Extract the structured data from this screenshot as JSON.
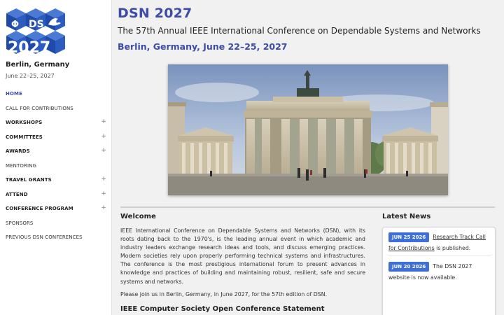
{
  "sidebar": {
    "logo": {
      "letters_top": "DS",
      "year": "2027"
    },
    "city": "Berlin, Germany",
    "dates": "June 22–25, 2027",
    "nav": [
      {
        "label": "HOME",
        "expandable": false
      },
      {
        "label": "CALL FOR CONTRIBUTIONS",
        "expandable": false
      },
      {
        "label": "WORKSHOPS",
        "expandable": true
      },
      {
        "label": "COMMITTEES",
        "expandable": true
      },
      {
        "label": "AWARDS",
        "expandable": true
      },
      {
        "label": "MENTORING",
        "expandable": false
      },
      {
        "label": "TRAVEL GRANTS",
        "expandable": true
      },
      {
        "label": "ATTEND",
        "expandable": true
      },
      {
        "label": "CONFERENCE PROGRAM",
        "expandable": true
      },
      {
        "label": "SPONSORS",
        "expandable": false
      },
      {
        "label": "PREVIOUS DSN CONFERENCES",
        "expandable": false
      }
    ],
    "expand_symbol": "+"
  },
  "main": {
    "title": "DSN 2027",
    "subtitle": "The 57th Annual IEEE International Conference on Dependable Systems and Networks",
    "location": "Berlin, Germany, June 22–25, 2027",
    "welcome": {
      "title": "Welcome",
      "body": "IEEE International Conference on Dependable Systems and Networks (DSN), with its roots dating back to the 1970's, is the leading annual event in which academic and industry leaders exchange research ideas and tools, and discuss emerging practices. Modern societies rely upon properly performing technical systems and infrastructures. The conference is the most prestigious international forum to present advances in knowledge and practices of building and maintaining robust, resilient, safe and secure systems and networks.",
      "join": "Please join us in Berlin, Germany, in June 2027, for the 57th edition of DSN.",
      "next_section": "IEEE Computer Society Open Conference Statement"
    },
    "news": {
      "title": "Latest News",
      "items": [
        {
          "date": "JUN 25 2026",
          "link": "Research Track Call for Contributions",
          "text": " is published."
        },
        {
          "date": "JUN 20 2026",
          "link": "",
          "text": "The DSN 2027 website is now available."
        }
      ]
    }
  },
  "colors": {
    "accent": "#3d4ca8",
    "badge": "#3e6fd8",
    "logo_blue": "#2a55b8"
  }
}
